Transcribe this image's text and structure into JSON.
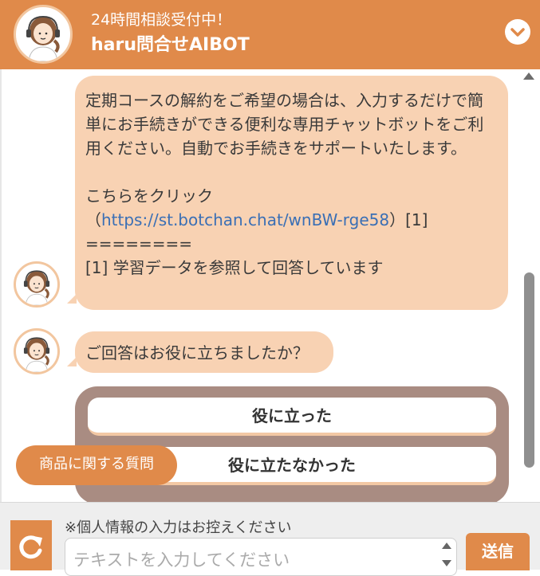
{
  "header": {
    "subtitle": "24時間相談受付中！",
    "title": "haru問合せAIBOT",
    "collapse_icon": "chevron-down-icon"
  },
  "messages": [
    {
      "paragraph1": "定期コースの解約をご希望の場合は、入力するだけで簡単にお手続きができる便利な専用チャットボットをご利用ください。自動でお手続きをサポートいたします。",
      "click_text": "こちらをクリック",
      "link_open": "（",
      "link_url": "https://st.botchan.chat/wnBW-rge58",
      "link_close": "）[1]",
      "separator": "========",
      "footnote": "[1] 学習データを参照して回答しています"
    },
    {
      "text": "ご回答はお役に立ちましたか？"
    }
  ],
  "choices": [
    "役に立った",
    "役に立たなかった"
  ],
  "faq_button": "商品に関する質問",
  "footer": {
    "notice": "※個人情報の入力はお控えください",
    "input_placeholder": "テキストを入力してください",
    "send_label": "送信",
    "refresh_icon": "refresh-icon"
  },
  "colors": {
    "brand": "#e08a4a",
    "bubble": "#f8d2b3",
    "choice_panel": "#a98c82",
    "link": "#3a6fb5"
  }
}
